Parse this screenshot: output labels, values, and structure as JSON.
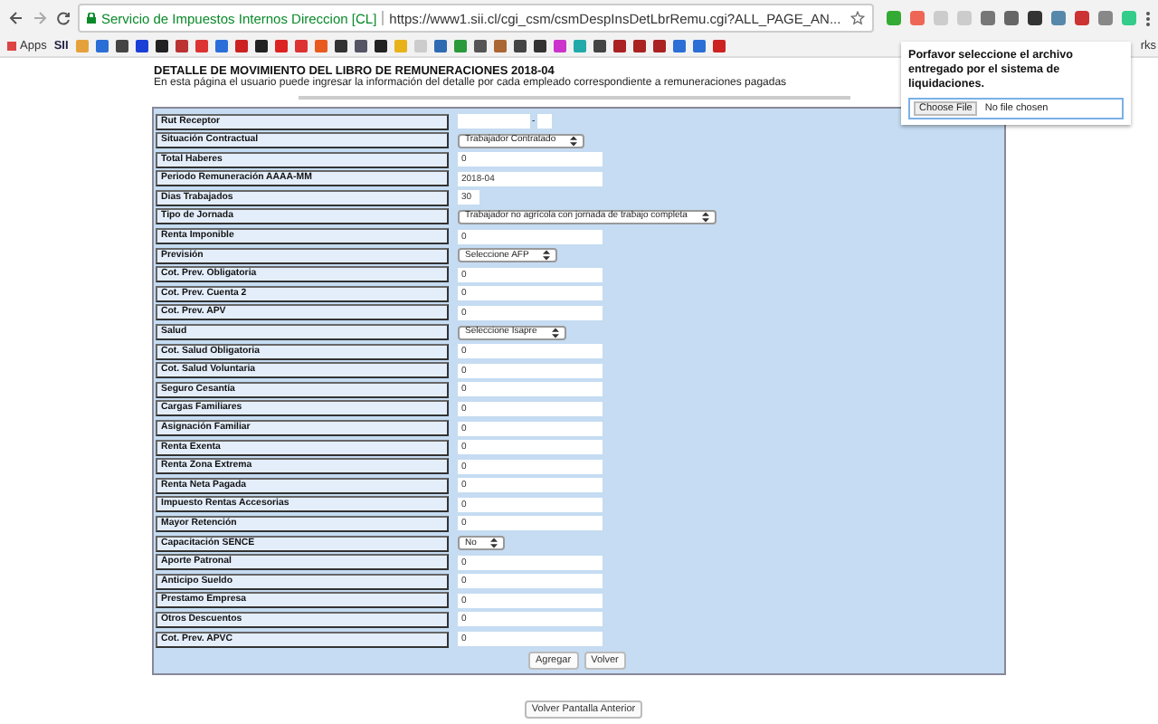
{
  "browser": {
    "site_name": "Servicio de Impuestos Internos Direccion [CL]",
    "url": "https://www1.sii.cl/cgi_csm/csmDespInsDetLbrRemu.cgi?ALL_PAGE_AN...",
    "bookmarks": [
      "Apps",
      "SII"
    ],
    "bookmarks_cut": "rks"
  },
  "popup": {
    "message": "Porfavor seleccione el archivo entregado por el sistema de liquidaciones.",
    "file_button": "Choose File",
    "file_status": "No file chosen"
  },
  "page": {
    "title": "DETALLE DE MOVIMIENTO DEL LIBRO DE REMUNERACIONES 2018-04",
    "subtitle": "En esta página el usuario puede ingresar la información del detalle por cada empleado correspondiente a remuneraciones pagadas"
  },
  "form": {
    "rows": [
      {
        "label": "Rut Receptor",
        "kind": "rut",
        "separator": "-"
      },
      {
        "label": "Situación Contractual",
        "kind": "select",
        "value": "Trabajador Contratado"
      },
      {
        "label": "Total Haberes",
        "kind": "text",
        "value": "0"
      },
      {
        "label": "Periodo Remuneración AAAA-MM",
        "kind": "text",
        "value": "2018-04"
      },
      {
        "label": "Dias Trabajados",
        "kind": "short",
        "value": "30"
      },
      {
        "label": "Tipo de Jornada",
        "kind": "select",
        "value": "Trabajador no agrícola con jornada de trabajo completa"
      },
      {
        "label": "Renta Imponible",
        "kind": "text",
        "value": "0"
      },
      {
        "label": "Previsión",
        "kind": "select",
        "value": "Seleccione AFP"
      },
      {
        "label": "Cot. Prev. Obligatoria",
        "kind": "text",
        "value": "0"
      },
      {
        "label": "Cot. Prev. Cuenta 2",
        "kind": "text",
        "value": "0"
      },
      {
        "label": "Cot. Prev. APV",
        "kind": "text",
        "value": "0"
      },
      {
        "label": "Salud",
        "kind": "select",
        "value": "Seleccione Isapre"
      },
      {
        "label": "Cot. Salud Obligatoria",
        "kind": "text",
        "value": "0"
      },
      {
        "label": "Cot. Salud Voluntaria",
        "kind": "text",
        "value": "0"
      },
      {
        "label": "Seguro Cesantía",
        "kind": "text",
        "value": "0"
      },
      {
        "label": "Cargas Familiares",
        "kind": "text",
        "value": "0"
      },
      {
        "label": "Asignación Familiar",
        "kind": "text",
        "value": "0"
      },
      {
        "label": "Renta Exenta",
        "kind": "text",
        "value": "0"
      },
      {
        "label": "Renta Zona Extrema",
        "kind": "text",
        "value": "0"
      },
      {
        "label": "Renta Neta Pagada",
        "kind": "text",
        "value": "0"
      },
      {
        "label": "Impuesto Rentas Accesorias",
        "kind": "text",
        "value": "0"
      },
      {
        "label": "Mayor Retención",
        "kind": "text",
        "value": "0"
      },
      {
        "label": "Capacitación SENCE",
        "kind": "select",
        "value": "No"
      },
      {
        "label": "Aporte Patronal",
        "kind": "text",
        "value": "0"
      },
      {
        "label": "Anticipo Sueldo",
        "kind": "text",
        "value": "0"
      },
      {
        "label": "Prestamo Empresa",
        "kind": "text",
        "value": "0"
      },
      {
        "label": "Otros Descuentos",
        "kind": "text",
        "value": "0"
      },
      {
        "label": "Cot. Prev. APVC",
        "kind": "text",
        "value": "0"
      }
    ],
    "buttons": [
      "Agregar",
      "Volver"
    ]
  },
  "back_button": "Volver Pantalla Anterior"
}
